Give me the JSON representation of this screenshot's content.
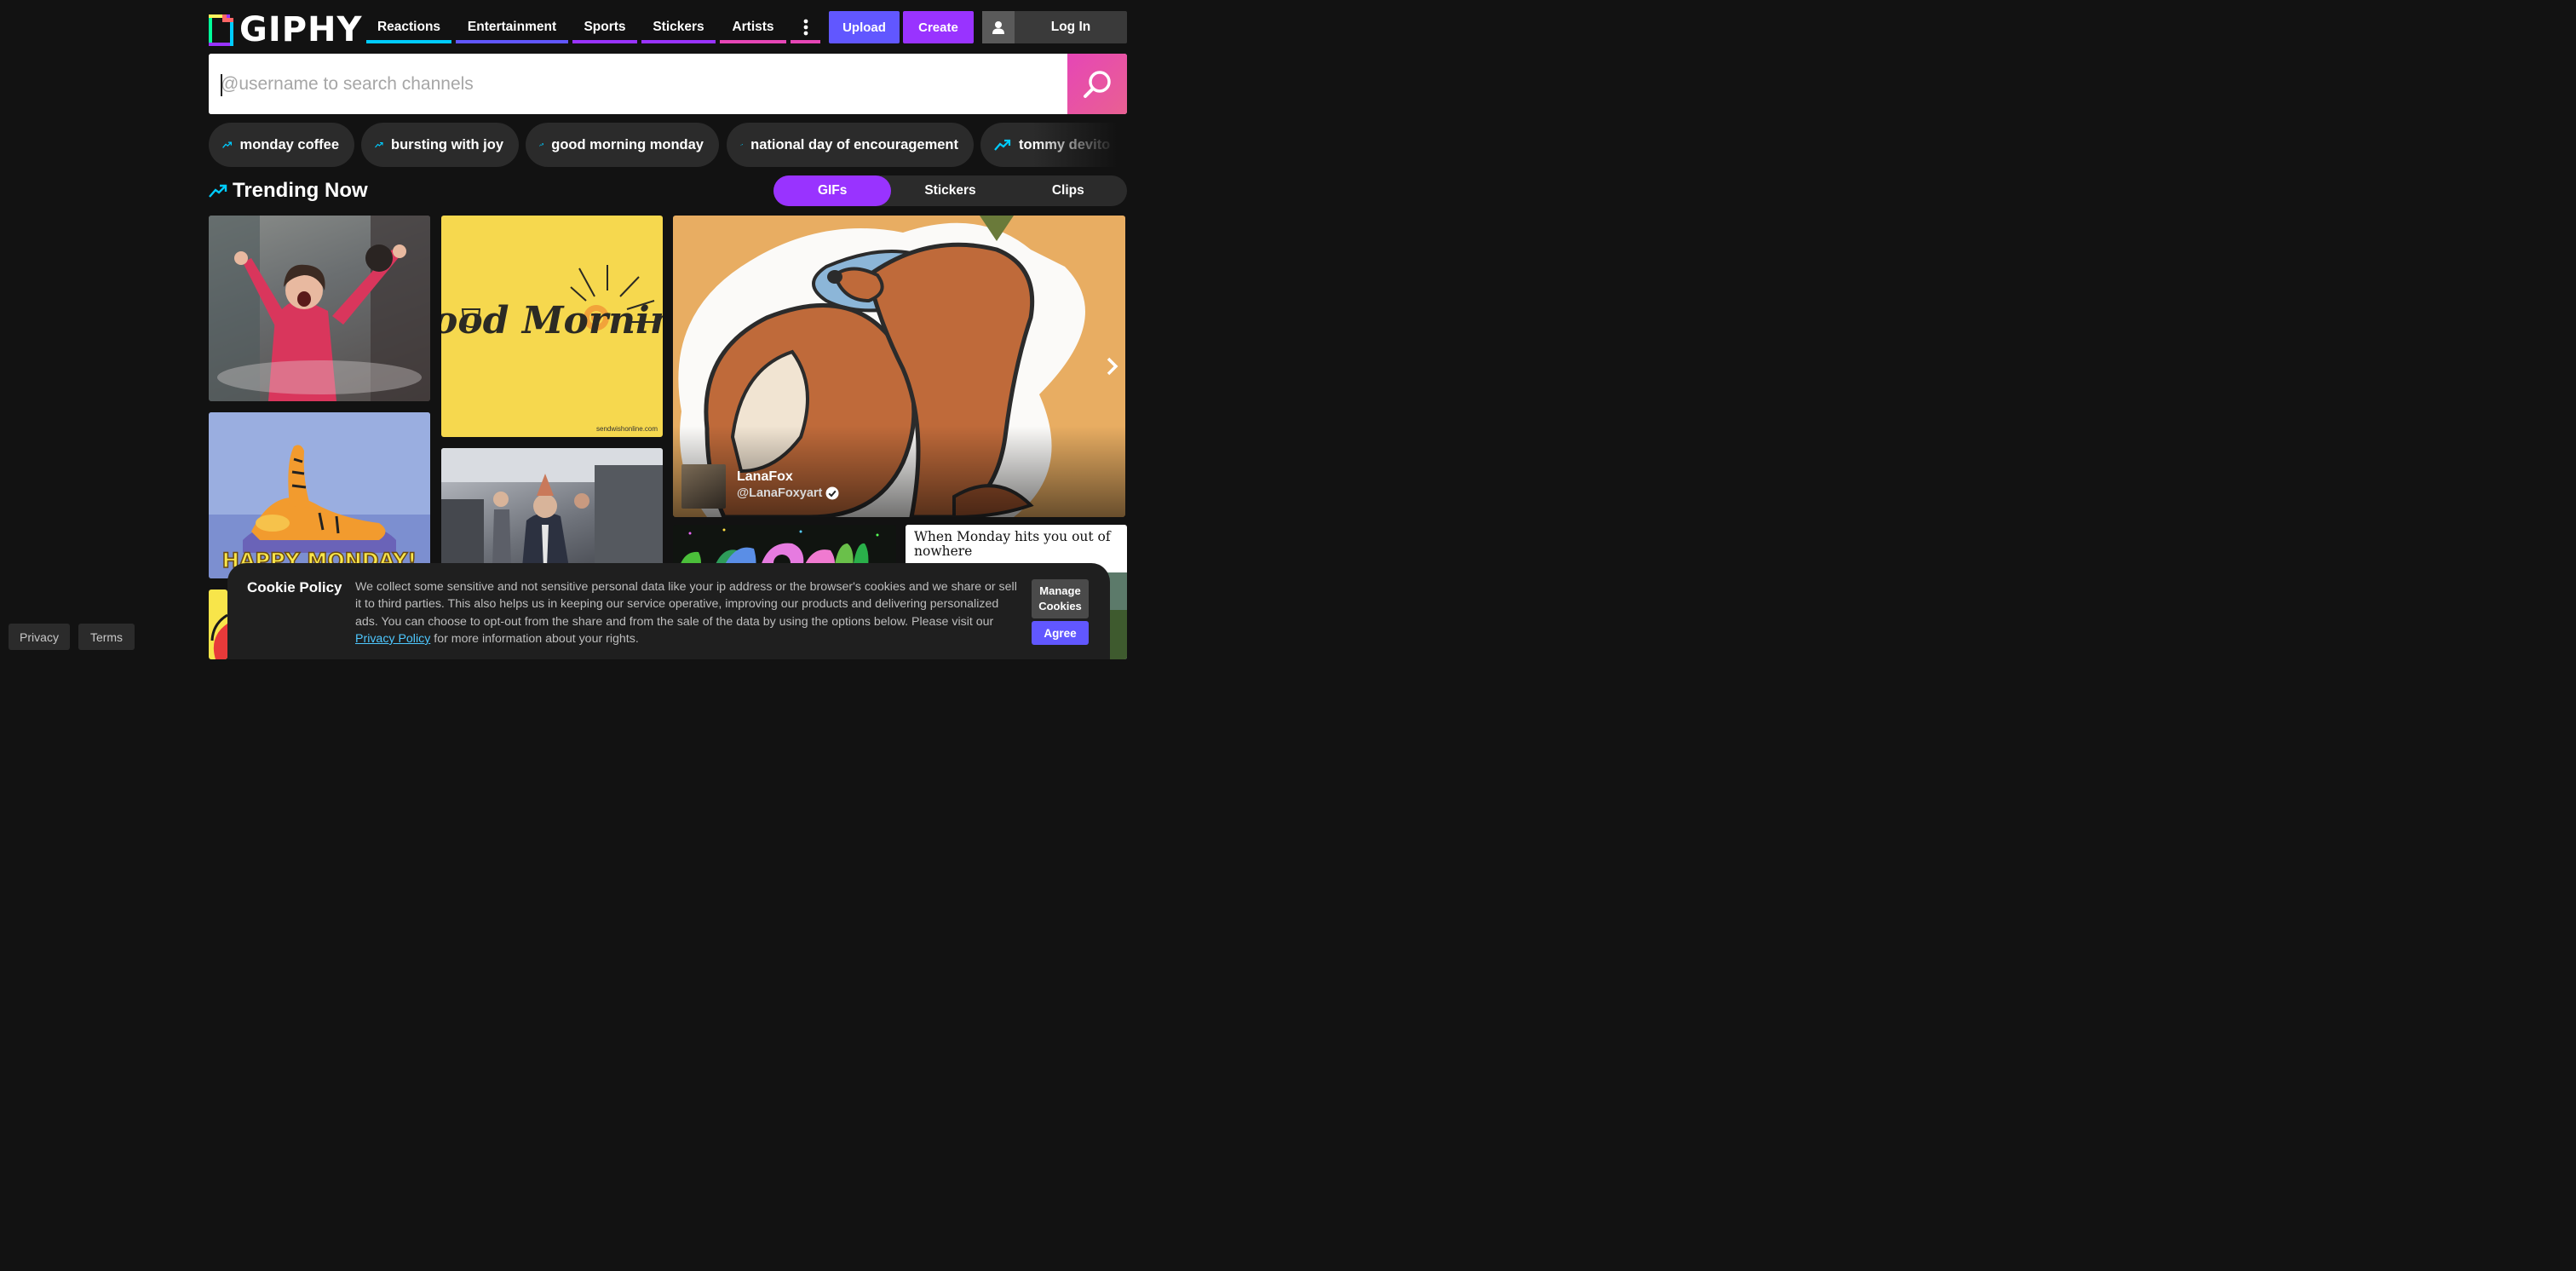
{
  "brand": {
    "name": "GIPHY"
  },
  "nav": {
    "items": [
      {
        "label": "Reactions",
        "color": "#00ccff"
      },
      {
        "label": "Entertainment",
        "color": "#6157ff"
      },
      {
        "label": "Sports",
        "color": "#9933ff"
      },
      {
        "label": "Stickers",
        "color": "#9933ff"
      },
      {
        "label": "Artists",
        "color": "#e646b6"
      }
    ],
    "more_icon": "more-vertical-icon",
    "more_color": "#e646b6"
  },
  "header": {
    "upload_label": "Upload",
    "create_label": "Create",
    "login_label": "Log In",
    "user_icon": "user-icon"
  },
  "search": {
    "placeholder": "@username to search channels",
    "value": "",
    "icon": "search-icon"
  },
  "trending_searches": [
    "monday coffee",
    "bursting with joy",
    "good morning monday",
    "national day of encouragement",
    "tommy devito"
  ],
  "trending": {
    "title": "Trending Now",
    "icon": "trending-arrow-icon",
    "tabs": [
      {
        "label": "GIFs",
        "active": true
      },
      {
        "label": "Stickers",
        "active": false
      },
      {
        "label": "Clips",
        "active": false
      }
    ]
  },
  "tiles": {
    "good_morning": {
      "text": "Good Morning",
      "watermark": "sendwishonline.com"
    },
    "happy_monday": {
      "text": "HAPPY MONDAY!"
    },
    "featured": {
      "display_name": "LanaFox",
      "handle": "@LanaFoxyart",
      "verified": true,
      "next_icon": "chevron-right-icon"
    },
    "when_monday": {
      "text": "When Monday hits you out of nowhere"
    }
  },
  "footer": {
    "privacy_label": "Privacy",
    "terms_label": "Terms"
  },
  "cookie": {
    "title": "Cookie Policy",
    "body_before_link": "We collect some sensitive and not sensitive personal data like your ip address or the browser's cookies and we share or sell it to third parties. This also helps us in keeping our service operative, improving our products and delivering personalized ads. You can choose to opt-out from the share and from the sale of the data by using the options below. Please visit our ",
    "link_text": "Privacy Policy",
    "body_after_link": " for more information about your rights.",
    "manage_label": "Manage Cookies",
    "agree_label": "Agree"
  },
  "colors": {
    "background": "#121212",
    "upload": "#6157ff",
    "create": "#9933ff",
    "search_button": "#e646b6",
    "tab_active": "#9933ff",
    "trend_icon": "#00ccff",
    "link": "#4ec8ff"
  }
}
